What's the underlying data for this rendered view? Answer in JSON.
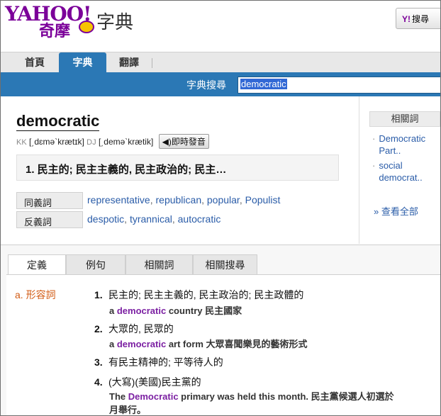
{
  "header": {
    "logo_top": "YAHOO!",
    "logo_bottom": "奇摩",
    "logo_section": "字典",
    "search_button_label": "搜尋"
  },
  "tabs": [
    {
      "label": "首頁"
    },
    {
      "label": "字典"
    },
    {
      "label": "翻譯"
    }
  ],
  "search": {
    "label": "字典搜尋",
    "value": "democratic"
  },
  "entry": {
    "word": "democratic",
    "kk_label": "KK",
    "kk_phonetic": "[͵dɛmə`krætɪk]",
    "dj_label": "DJ",
    "dj_phonetic": "[͵demə`krætik]",
    "audio_label": "◀)即時發音",
    "summary": "1. 民主的; 民主主義的, 民主政治的; 民主…"
  },
  "synonyms": {
    "label": "同義詞",
    "items": [
      "representative",
      "republican",
      "popular",
      "Populist"
    ]
  },
  "antonyms": {
    "label": "反義詞",
    "items": [
      "despotic",
      "tyrannical",
      "autocratic"
    ]
  },
  "sidebar": {
    "title": "相關詞",
    "items": [
      "Democratic Part..",
      "social democrat.."
    ],
    "see_all": "» 查看全部"
  },
  "def_tabs": [
    "定義",
    "例句",
    "相關詞",
    "相關搜尋"
  ],
  "definitions": {
    "pos": "a. 形容詞",
    "senses": [
      {
        "num": "1.",
        "text": "民主的; 民主主義的, 民主政治的; 民主政體的",
        "example_pre": "a ",
        "example_hl": "democratic",
        "example_post": " country 民主國家"
      },
      {
        "num": "2.",
        "text": "大眾的, 民眾的",
        "example_pre": "a ",
        "example_hl": "democratic",
        "example_post": " art form 大眾喜聞樂見的藝術形式"
      },
      {
        "num": "3.",
        "text": "有民主精神的; 平等待人的"
      },
      {
        "num": "4.",
        "text": "(大寫)(美國)民主黨的",
        "example_pre": "The ",
        "example_hl": "Democratic",
        "example_post": " primary was held this month. 民主黨候選人初選於",
        "example_line2": "月舉行。"
      }
    ]
  },
  "colors": {
    "brand": "#7b0099",
    "nav_blue": "#2b78b5",
    "link": "#2a5ca8",
    "pos_orange": "#d25b14",
    "highlight": "#7b1fa2"
  }
}
